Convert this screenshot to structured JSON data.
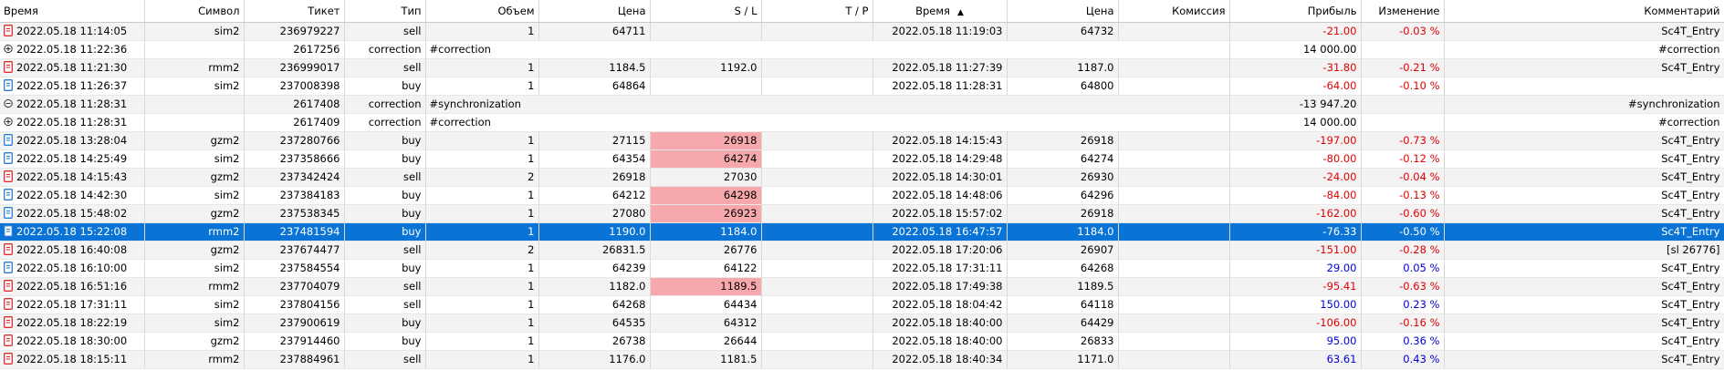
{
  "columns": [
    {
      "key": "time_open",
      "label": "Время"
    },
    {
      "key": "symbol",
      "label": "Символ"
    },
    {
      "key": "ticket",
      "label": "Тикет"
    },
    {
      "key": "type",
      "label": "Тип"
    },
    {
      "key": "volume",
      "label": "Объем"
    },
    {
      "key": "price_open",
      "label": "Цена"
    },
    {
      "key": "sl",
      "label": "S / L"
    },
    {
      "key": "tp",
      "label": "T / P"
    },
    {
      "key": "time_close",
      "label": "Время"
    },
    {
      "key": "price_close",
      "label": "Цена"
    },
    {
      "key": "commission",
      "label": "Комиссия"
    },
    {
      "key": "profit",
      "label": "Прибыль"
    },
    {
      "key": "change",
      "label": "Изменение"
    },
    {
      "key": "comment",
      "label": "Комментарий"
    }
  ],
  "sort_indicator": "▲",
  "colors": {
    "sell_icon": "#d83030",
    "buy_icon": "#2a7fd4",
    "selected": "#0a74d6",
    "sl_highlight": "#f7a8ac",
    "negative": "#e00000",
    "positive": "#0000d8"
  },
  "rows": [
    {
      "icon": "sell",
      "time_open": "2022.05.18 11:14:05",
      "symbol": "sim2",
      "ticket": "236979227",
      "type": "sell",
      "volume": "1",
      "price_open": "64711",
      "sl": "",
      "tp": "",
      "time_close": "2022.05.18 11:19:03",
      "price_close": "64732",
      "commission": "",
      "profit": "-21.00",
      "change": "-0.03 %",
      "comment": "Sc4T_Entry"
    },
    {
      "icon": "plus",
      "time_open": "2022.05.18 11:22:36",
      "symbol": "",
      "ticket": "2617256",
      "type": "correction",
      "note": "#correction",
      "profit": "14 000.00",
      "change": "",
      "comment": "#correction"
    },
    {
      "icon": "sell",
      "time_open": "2022.05.18 11:21:30",
      "symbol": "rmm2",
      "ticket": "236999017",
      "type": "sell",
      "volume": "1",
      "price_open": "1184.5",
      "sl": "1192.0",
      "tp": "",
      "time_close": "2022.05.18 11:27:39",
      "price_close": "1187.0",
      "commission": "",
      "profit": "-31.80",
      "change": "-0.21 %",
      "comment": "Sc4T_Entry"
    },
    {
      "icon": "buy",
      "time_open": "2022.05.18 11:26:37",
      "symbol": "sim2",
      "ticket": "237008398",
      "type": "buy",
      "volume": "1",
      "price_open": "64864",
      "sl": "",
      "tp": "",
      "time_close": "2022.05.18 11:28:31",
      "price_close": "64800",
      "commission": "",
      "profit": "-64.00",
      "change": "-0.10 %",
      "comment": ""
    },
    {
      "icon": "minus",
      "time_open": "2022.05.18 11:28:31",
      "symbol": "",
      "ticket": "2617408",
      "type": "correction",
      "note": "#synchronization",
      "profit": "-13 947.20",
      "change": "",
      "comment": "#synchronization"
    },
    {
      "icon": "plus",
      "time_open": "2022.05.18 11:28:31",
      "symbol": "",
      "ticket": "2617409",
      "type": "correction",
      "note": "#correction",
      "profit": "14 000.00",
      "change": "",
      "comment": "#correction"
    },
    {
      "icon": "buy",
      "time_open": "2022.05.18 13:28:04",
      "symbol": "gzm2",
      "ticket": "237280766",
      "type": "buy",
      "volume": "1",
      "price_open": "27115",
      "sl": "26918",
      "sl_hl": true,
      "tp": "",
      "time_close": "2022.05.18 14:15:43",
      "price_close": "26918",
      "commission": "",
      "profit": "-197.00",
      "change": "-0.73 %",
      "comment": "Sc4T_Entry"
    },
    {
      "icon": "buy",
      "time_open": "2022.05.18 14:25:49",
      "symbol": "sim2",
      "ticket": "237358666",
      "type": "buy",
      "volume": "1",
      "price_open": "64354",
      "sl": "64274",
      "sl_hl": true,
      "tp": "",
      "time_close": "2022.05.18 14:29:48",
      "price_close": "64274",
      "commission": "",
      "profit": "-80.00",
      "change": "-0.12 %",
      "comment": "Sc4T_Entry"
    },
    {
      "icon": "sell",
      "time_open": "2022.05.18 14:15:43",
      "symbol": "gzm2",
      "ticket": "237342424",
      "type": "sell",
      "volume": "2",
      "price_open": "26918",
      "sl": "27030",
      "tp": "",
      "time_close": "2022.05.18 14:30:01",
      "price_close": "26930",
      "commission": "",
      "profit": "-24.00",
      "change": "-0.04 %",
      "comment": "Sc4T_Entry"
    },
    {
      "icon": "buy",
      "time_open": "2022.05.18 14:42:30",
      "symbol": "sim2",
      "ticket": "237384183",
      "type": "buy",
      "volume": "1",
      "price_open": "64212",
      "sl": "64298",
      "sl_hl": true,
      "tp": "",
      "time_close": "2022.05.18 14:48:06",
      "price_close": "64296",
      "commission": "",
      "profit": "-84.00",
      "change": "-0.13 %",
      "comment": "Sc4T_Entry"
    },
    {
      "icon": "buy",
      "time_open": "2022.05.18 15:48:02",
      "symbol": "gzm2",
      "ticket": "237538345",
      "type": "buy",
      "volume": "1",
      "price_open": "27080",
      "sl": "26923",
      "sl_hl": true,
      "tp": "",
      "time_close": "2022.05.18 15:57:02",
      "price_close": "26918",
      "commission": "",
      "profit": "-162.00",
      "change": "-0.60 %",
      "comment": "Sc4T_Entry"
    },
    {
      "icon": "buy",
      "selected": true,
      "time_open": "2022.05.18 15:22:08",
      "symbol": "rmm2",
      "ticket": "237481594",
      "type": "buy",
      "volume": "1",
      "price_open": "1190.0",
      "sl": "1184.0",
      "tp": "",
      "time_close": "2022.05.18 16:47:57",
      "price_close": "1184.0",
      "commission": "",
      "profit": "-76.33",
      "change": "-0.50 %",
      "comment": "Sc4T_Entry"
    },
    {
      "icon": "sell",
      "time_open": "2022.05.18 16:40:08",
      "symbol": "gzm2",
      "ticket": "237674477",
      "type": "sell",
      "volume": "2",
      "price_open": "26831.5",
      "sl": "26776",
      "tp": "",
      "time_close": "2022.05.18 17:20:06",
      "price_close": "26907",
      "commission": "",
      "profit": "-151.00",
      "change": "-0.28 %",
      "comment": "[sl 26776]"
    },
    {
      "icon": "buy",
      "time_open": "2022.05.18 16:10:00",
      "symbol": "sim2",
      "ticket": "237584554",
      "type": "buy",
      "volume": "1",
      "price_open": "64239",
      "sl": "64122",
      "tp": "",
      "time_close": "2022.05.18 17:31:11",
      "price_close": "64268",
      "commission": "",
      "profit": "29.00",
      "change": "0.05 %",
      "comment": "Sc4T_Entry"
    },
    {
      "icon": "sell",
      "time_open": "2022.05.18 16:51:16",
      "symbol": "rmm2",
      "ticket": "237704079",
      "type": "sell",
      "volume": "1",
      "price_open": "1182.0",
      "sl": "1189.5",
      "sl_hl": true,
      "tp": "",
      "time_close": "2022.05.18 17:49:38",
      "price_close": "1189.5",
      "commission": "",
      "profit": "-95.41",
      "change": "-0.63 %",
      "comment": "Sc4T_Entry"
    },
    {
      "icon": "sell",
      "time_open": "2022.05.18 17:31:11",
      "symbol": "sim2",
      "ticket": "237804156",
      "type": "sell",
      "volume": "1",
      "price_open": "64268",
      "sl": "64434",
      "tp": "",
      "time_close": "2022.05.18 18:04:42",
      "price_close": "64118",
      "commission": "",
      "profit": "150.00",
      "change": "0.23 %",
      "comment": "Sc4T_Entry"
    },
    {
      "icon": "sell",
      "time_open": "2022.05.18 18:22:19",
      "symbol": "sim2",
      "ticket": "237900619",
      "type": "buy",
      "volume": "1",
      "price_open": "64535",
      "sl": "64312",
      "tp": "",
      "time_close": "2022.05.18 18:40:00",
      "price_close": "64429",
      "commission": "",
      "profit": "-106.00",
      "change": "-0.16 %",
      "comment": "Sc4T_Entry"
    },
    {
      "icon": "sell",
      "time_open": "2022.05.18 18:30:00",
      "symbol": "gzm2",
      "ticket": "237914460",
      "type": "buy",
      "volume": "1",
      "price_open": "26738",
      "sl": "26644",
      "tp": "",
      "time_close": "2022.05.18 18:40:00",
      "price_close": "26833",
      "commission": "",
      "profit": "95.00",
      "change": "0.36 %",
      "comment": "Sc4T_Entry"
    },
    {
      "icon": "sell",
      "time_open": "2022.05.18 18:15:11",
      "symbol": "rmm2",
      "ticket": "237884961",
      "type": "sell",
      "volume": "1",
      "price_open": "1176.0",
      "sl": "1181.5",
      "tp": "",
      "time_close": "2022.05.18 18:40:34",
      "price_close": "1171.0",
      "commission": "",
      "profit": "63.61",
      "change": "0.43 %",
      "comment": "Sc4T_Entry"
    }
  ]
}
